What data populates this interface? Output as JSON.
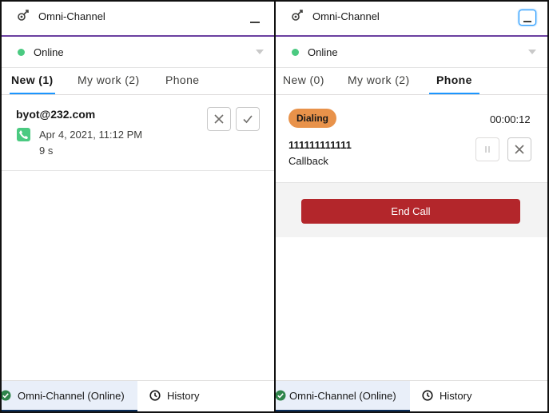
{
  "left_panel": {
    "header": {
      "title": "Omni-Channel"
    },
    "status": {
      "label": "Online"
    },
    "tabs": [
      {
        "label": "New (1)",
        "active": true
      },
      {
        "label": "My work (2)",
        "active": false
      },
      {
        "label": "Phone",
        "active": false
      }
    ],
    "work_item": {
      "title": "byot@232.com",
      "icon": "phone-icon",
      "datetime": "Apr 4, 2021, 11:12 PM",
      "duration": "9 s"
    },
    "footer": {
      "tabs": [
        {
          "label": "Omni-Channel (Online)",
          "icon": "check-circle-icon",
          "active": true
        },
        {
          "label": "History",
          "icon": "clock-icon",
          "active": false
        }
      ]
    }
  },
  "right_panel": {
    "header": {
      "title": "Omni-Channel"
    },
    "status": {
      "label": "Online"
    },
    "tabs": [
      {
        "label": "New (0)",
        "active": false
      },
      {
        "label": "My work (2)",
        "active": false
      },
      {
        "label": "Phone",
        "active": true
      }
    ],
    "call": {
      "status_badge": "Dialing",
      "timer": "00:00:12",
      "number": "111111111111",
      "type": "Callback",
      "end_call_label": "End Call"
    },
    "footer": {
      "tabs": [
        {
          "label": "Omni-Channel (Online)",
          "icon": "check-circle-icon",
          "active": true
        },
        {
          "label": "History",
          "icon": "clock-icon",
          "active": false
        }
      ]
    }
  },
  "colors": {
    "online": "#4bca81",
    "header_underline": "#6b3fa0",
    "active_tab": "#1b96ff",
    "dialing_badge": "#e8924a",
    "end_call": "#b3262b",
    "footer_active_bg": "#e9eff9"
  }
}
